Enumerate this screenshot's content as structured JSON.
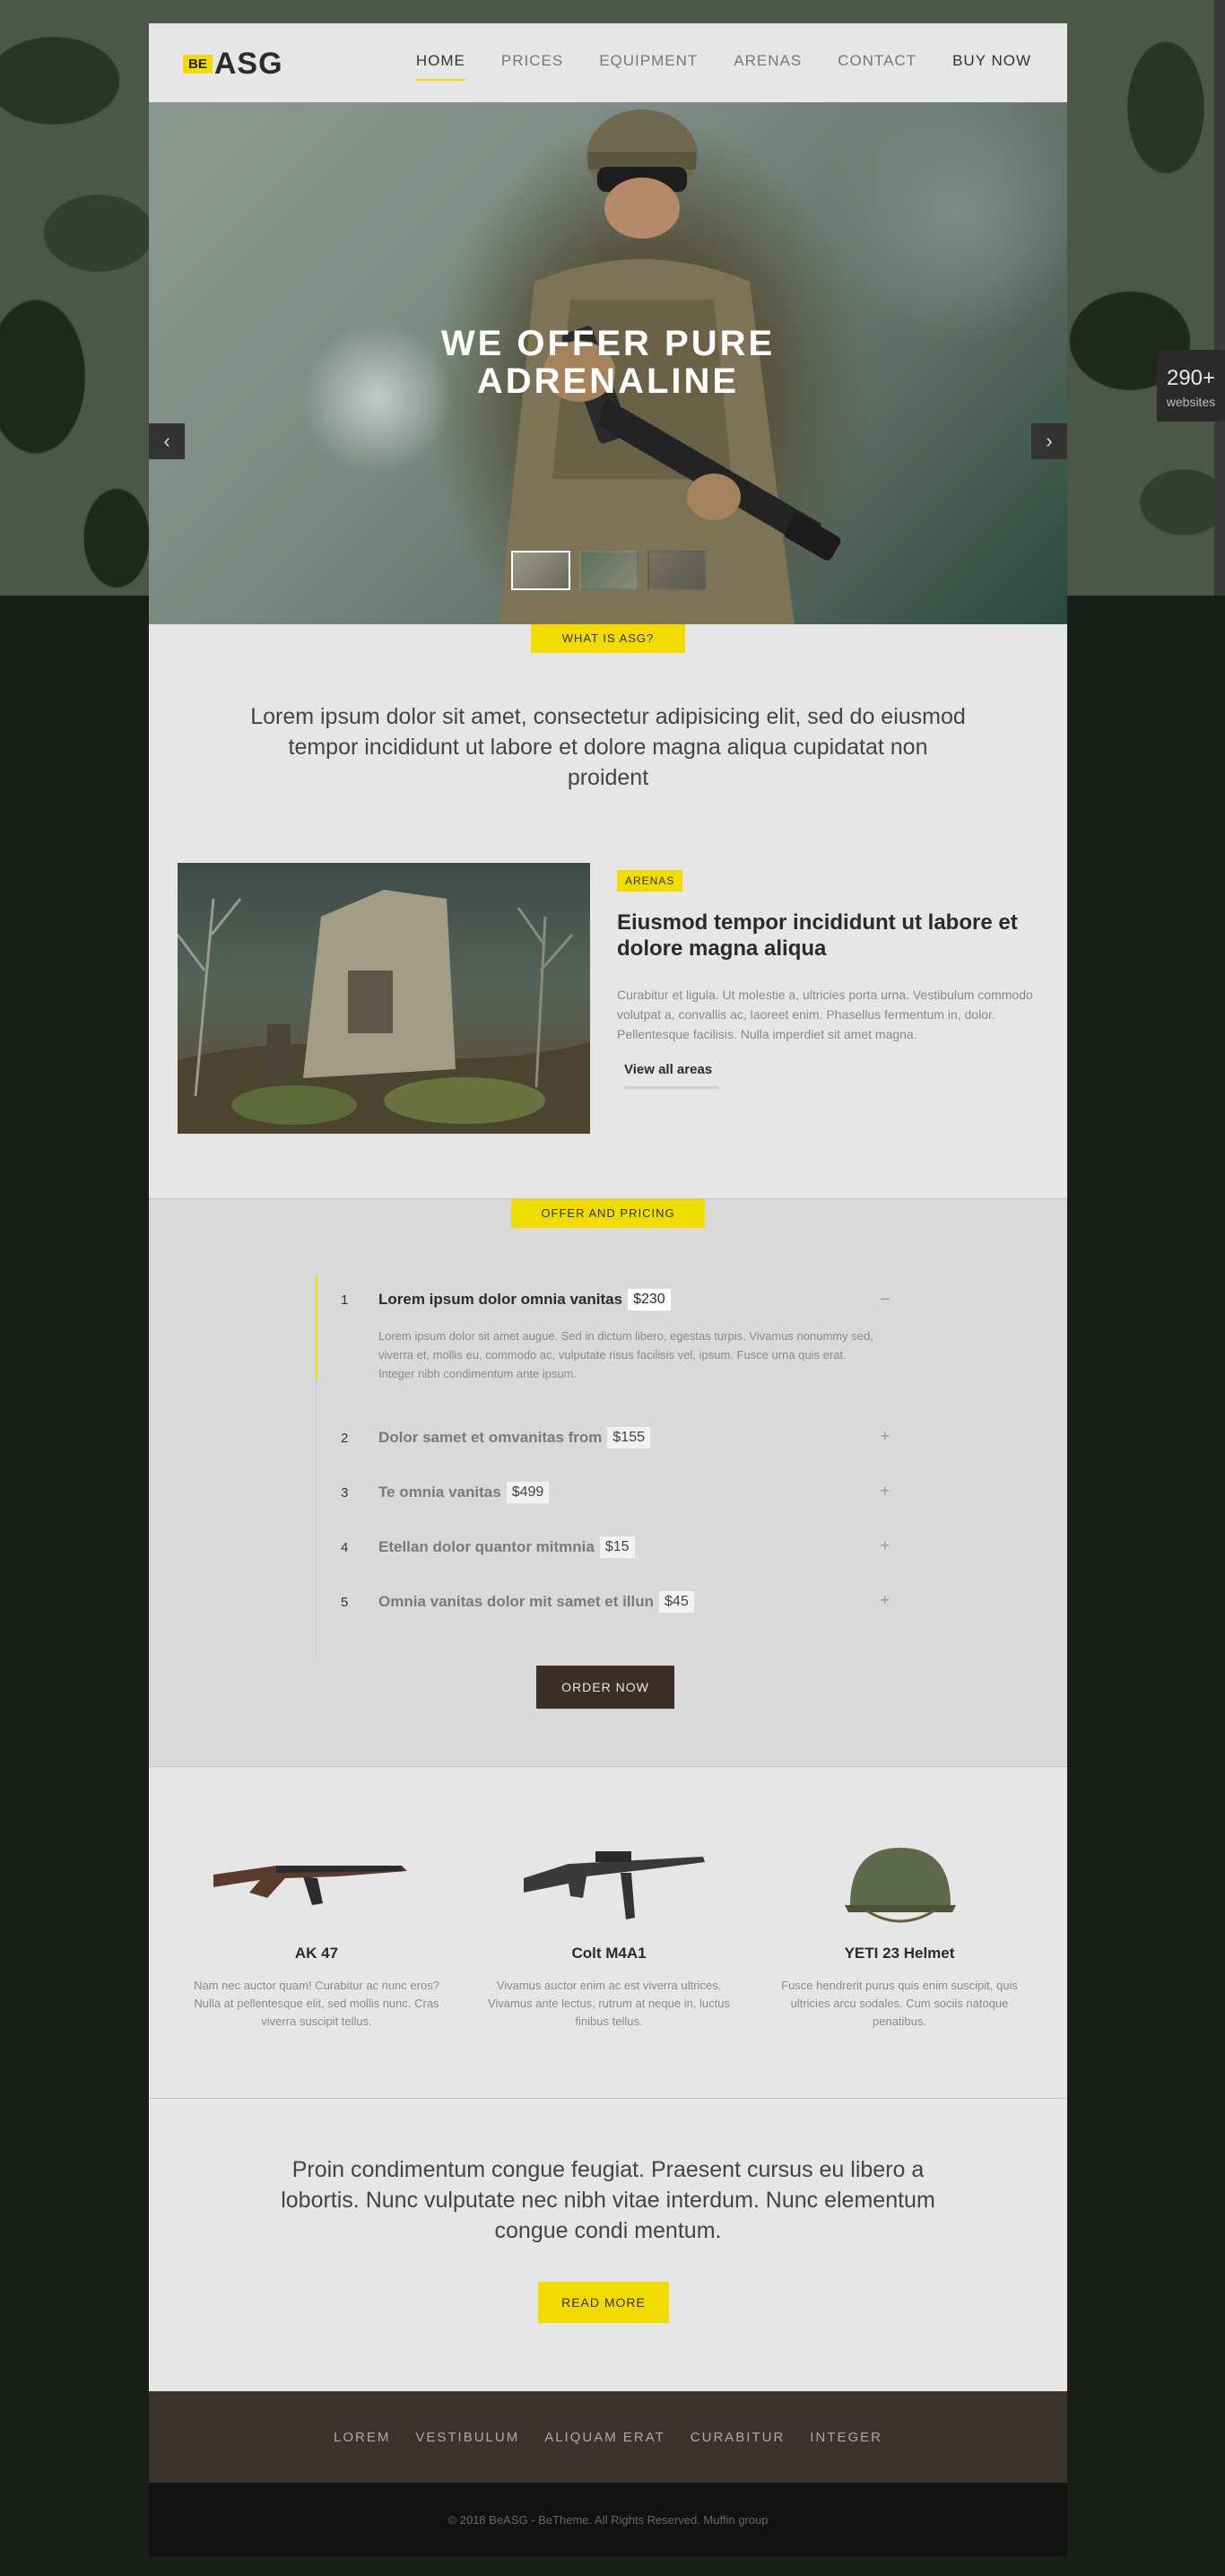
{
  "brand": {
    "badge": "BE",
    "name": "ASG",
    "accent": "#f2dc00"
  },
  "nav": {
    "items": [
      {
        "label": "HOME",
        "active": true
      },
      {
        "label": "PRICES"
      },
      {
        "label": "EQUIPMENT"
      },
      {
        "label": "ARENAS"
      },
      {
        "label": "CONTACT"
      },
      {
        "label": "BUY NOW"
      }
    ]
  },
  "side_badge": {
    "count": "290+",
    "label": "websites"
  },
  "hero": {
    "title_line1": "WE OFFER PURE",
    "title_line2": "ADRENALINE",
    "prev_icon": "‹",
    "next_icon": "›"
  },
  "about": {
    "tag": "WHAT IS ASG?",
    "text": "Lorem ipsum dolor sit amet, consectetur adipisicing elit, sed do eiusmod tempor incididunt ut labore et dolore magna aliqua cupidatat non proident"
  },
  "arenas": {
    "tag": "ARENAS",
    "title": "Eiusmod tempor incididunt ut labore et dolore magna aliqua",
    "description": "Curabitur et ligula. Ut molestie a, ultricies porta urna. Vestibulum commodo volutpat a, convallis ac, laoreet enim. Phasellus fermentum in, dolor. Pellentesque facilisis. Nulla imperdiet sit amet magna.",
    "link": "View all areas"
  },
  "pricing": {
    "tag": "OFFER AND PRICING",
    "items": [
      {
        "num": "1",
        "title": "Lorem ipsum dolor omnia vanitas",
        "price": "$230",
        "toggle": "–",
        "body": "Lorem ipsum dolor sit amet augue. Sed in dictum libero, egestas turpis. Vivamus nonummy sed, viverra et, mollis eu, commodo ac, vulputate risus facilisis vel, ipsum. Fusce urna quis erat. Integer nibh condimentum ante ipsum."
      },
      {
        "num": "2",
        "title": "Dolor samet et omvanitas from",
        "price": "$155",
        "toggle": "+"
      },
      {
        "num": "3",
        "title": "Te omnia vanitas",
        "price": "$499",
        "toggle": "+"
      },
      {
        "num": "4",
        "title": "Etellan dolor quantor mitmnia",
        "price": "$15",
        "toggle": "+"
      },
      {
        "num": "5",
        "title": "Omnia vanitas dolor mit samet et illun",
        "price": "$45",
        "toggle": "+"
      }
    ],
    "button": "ORDER NOW"
  },
  "equipment": [
    {
      "name": "AK 47",
      "desc": "Nam nec auctor quam! Curabitur ac nunc eros? Nulla at pellentesque elit, sed mollis nunc. Cras viverra suscipit tellus.",
      "icon": "rifle-icon"
    },
    {
      "name": "Colt M4A1",
      "desc": "Vivamus auctor enim ac est viverra ultrices. Vivamus ante lectus, rutrum at neque in, luctus finibus tellus.",
      "icon": "rifle-icon"
    },
    {
      "name": "YETI 23 Helmet",
      "desc": "Fusce hendrerit purus quis enim suscipit, quis ultricies arcu sodales. Cum sociis natoque penatibus.",
      "icon": "helmet-icon"
    }
  ],
  "quote": {
    "text": "Proin condimentum congue feugiat. Praesent cursus eu libero a lobortis. Nunc vulputate nec nibh vitae interdum. Nunc elementum congue condi mentum.",
    "button": "READ MORE"
  },
  "footer": {
    "links": [
      "LOREM",
      "VESTIBULUM",
      "ALIQUAM ERAT",
      "CURABITUR",
      "INTEGER"
    ],
    "copyright": "© 2018 BeASG - BeTheme. All Rights Reserved. Muffin group"
  }
}
